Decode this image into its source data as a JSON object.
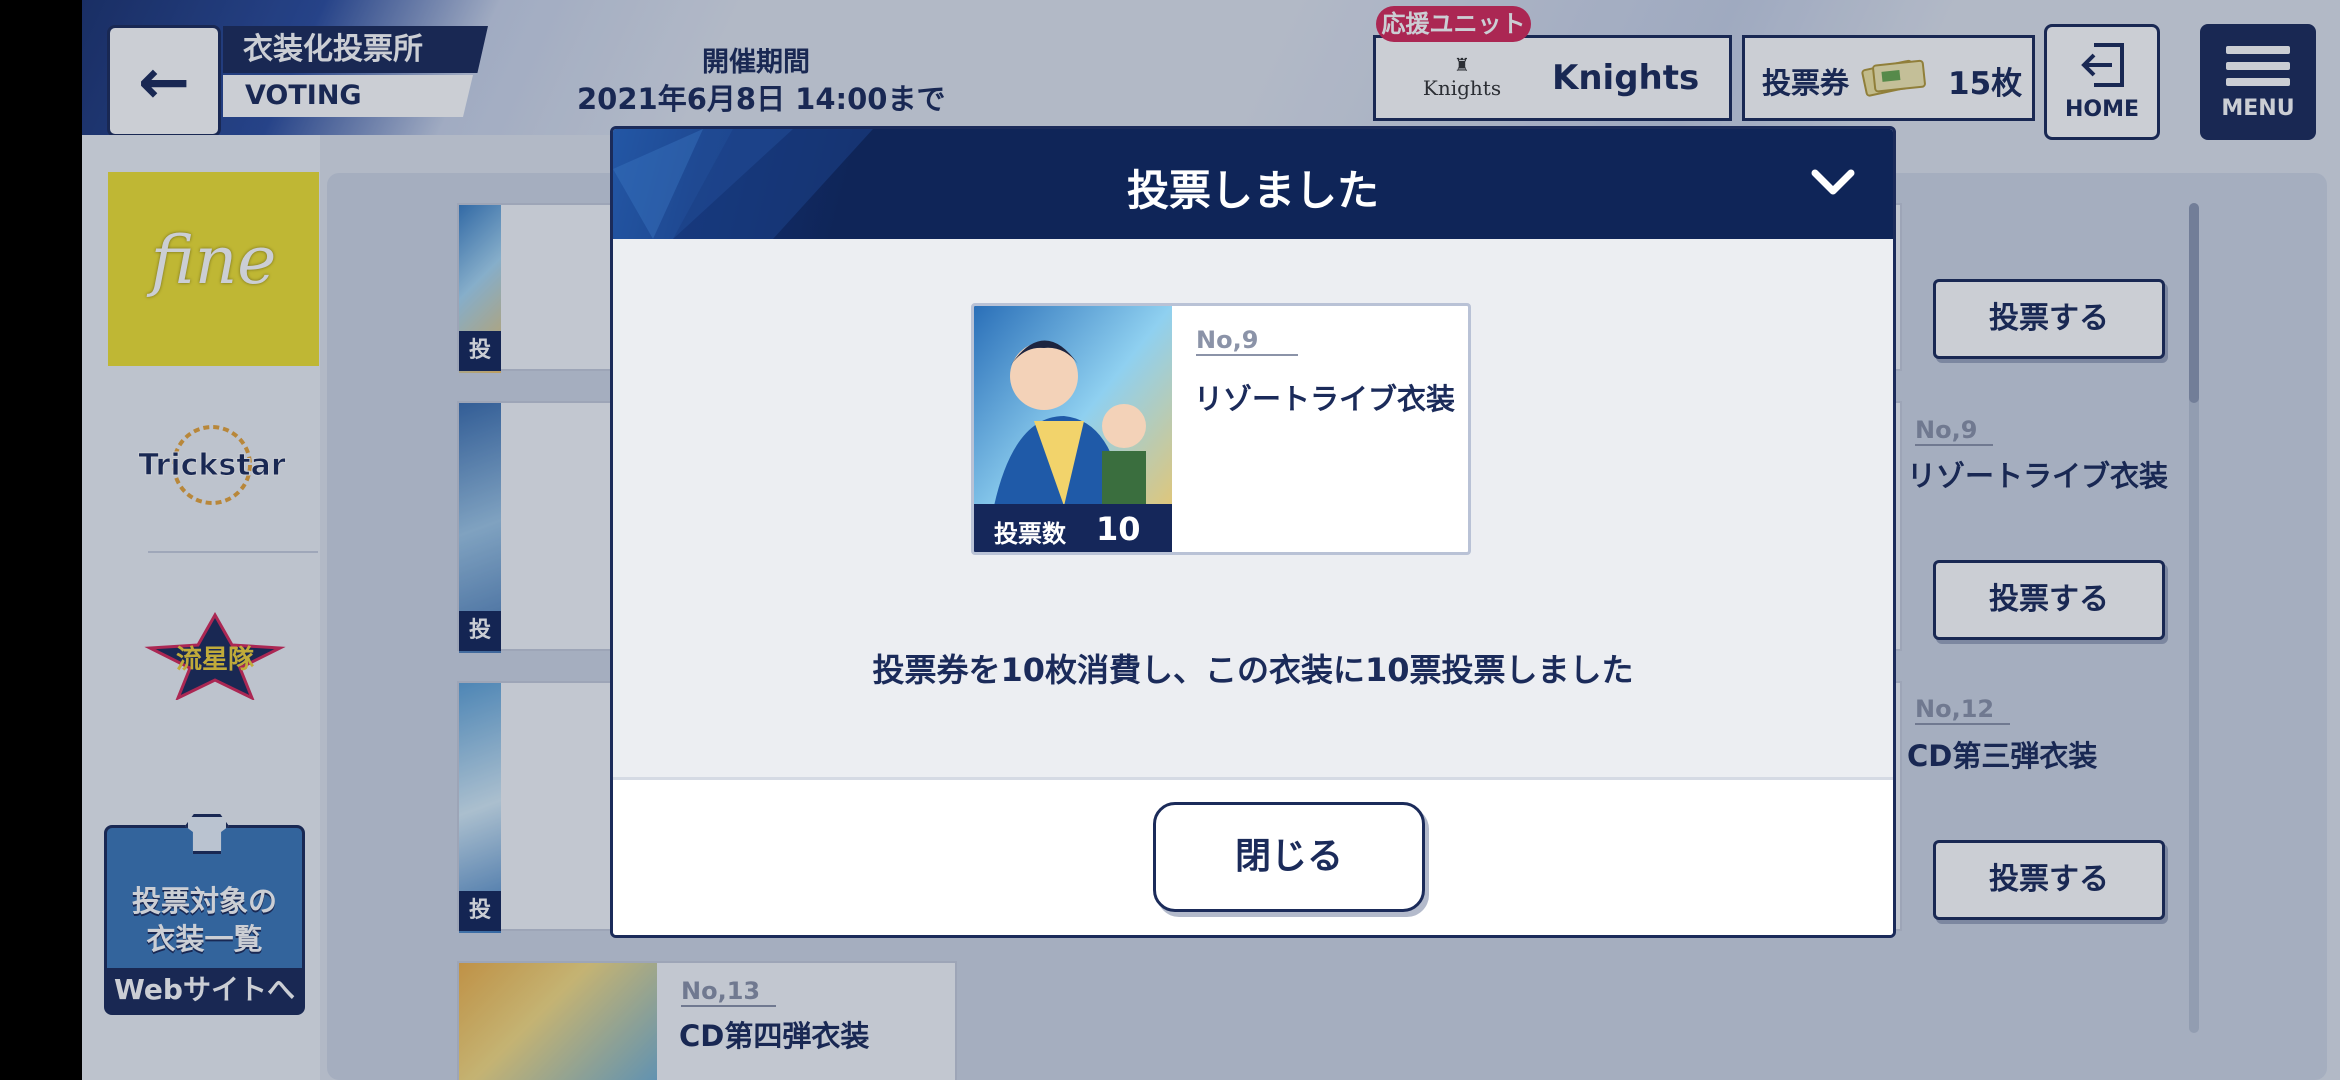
{
  "header": {
    "title": "衣装化投票所",
    "subtitle": "VOTING",
    "period_label": "開催期間",
    "period_value": "2021年6月8日 14:00まで",
    "support_tag": "応援ユニット",
    "support_logo": "Knights",
    "support_unit": "Knights",
    "ticket_label": "投票券",
    "ticket_count": "15枚",
    "home_label": "HOME",
    "menu_label": "MENU"
  },
  "sidebar": {
    "units": [
      "fine",
      "Trickstar",
      "流星隊"
    ],
    "costume_link": {
      "line1": "投票対象の",
      "line2": "衣装一覧",
      "web": "Webサイトへ"
    }
  },
  "list": {
    "left_labels": [
      "投",
      "投",
      "投"
    ],
    "items": [
      {
        "no": "No,9",
        "name": "リゾートライブ衣装",
        "button": "投票する"
      },
      {
        "no": "No,12",
        "name": "CD第三弾衣装",
        "button": "投票する"
      },
      {
        "no": "No,13",
        "name": "CD第四弾衣装"
      }
    ],
    "top_button": "投票する"
  },
  "modal": {
    "title": "投票しました",
    "card": {
      "no": "No,9",
      "name": "リゾートライブ衣装",
      "votes_label": "投票数",
      "votes_value": "10"
    },
    "message": "投票券を10枚消費し、この衣装に10票投票しました",
    "close_button": "閉じる"
  },
  "colors": {
    "navy": "#1b2b5a",
    "accent_pink": "#d6295a",
    "fine_yellow": "#f0e232",
    "link_blue": "#3d78b8"
  }
}
